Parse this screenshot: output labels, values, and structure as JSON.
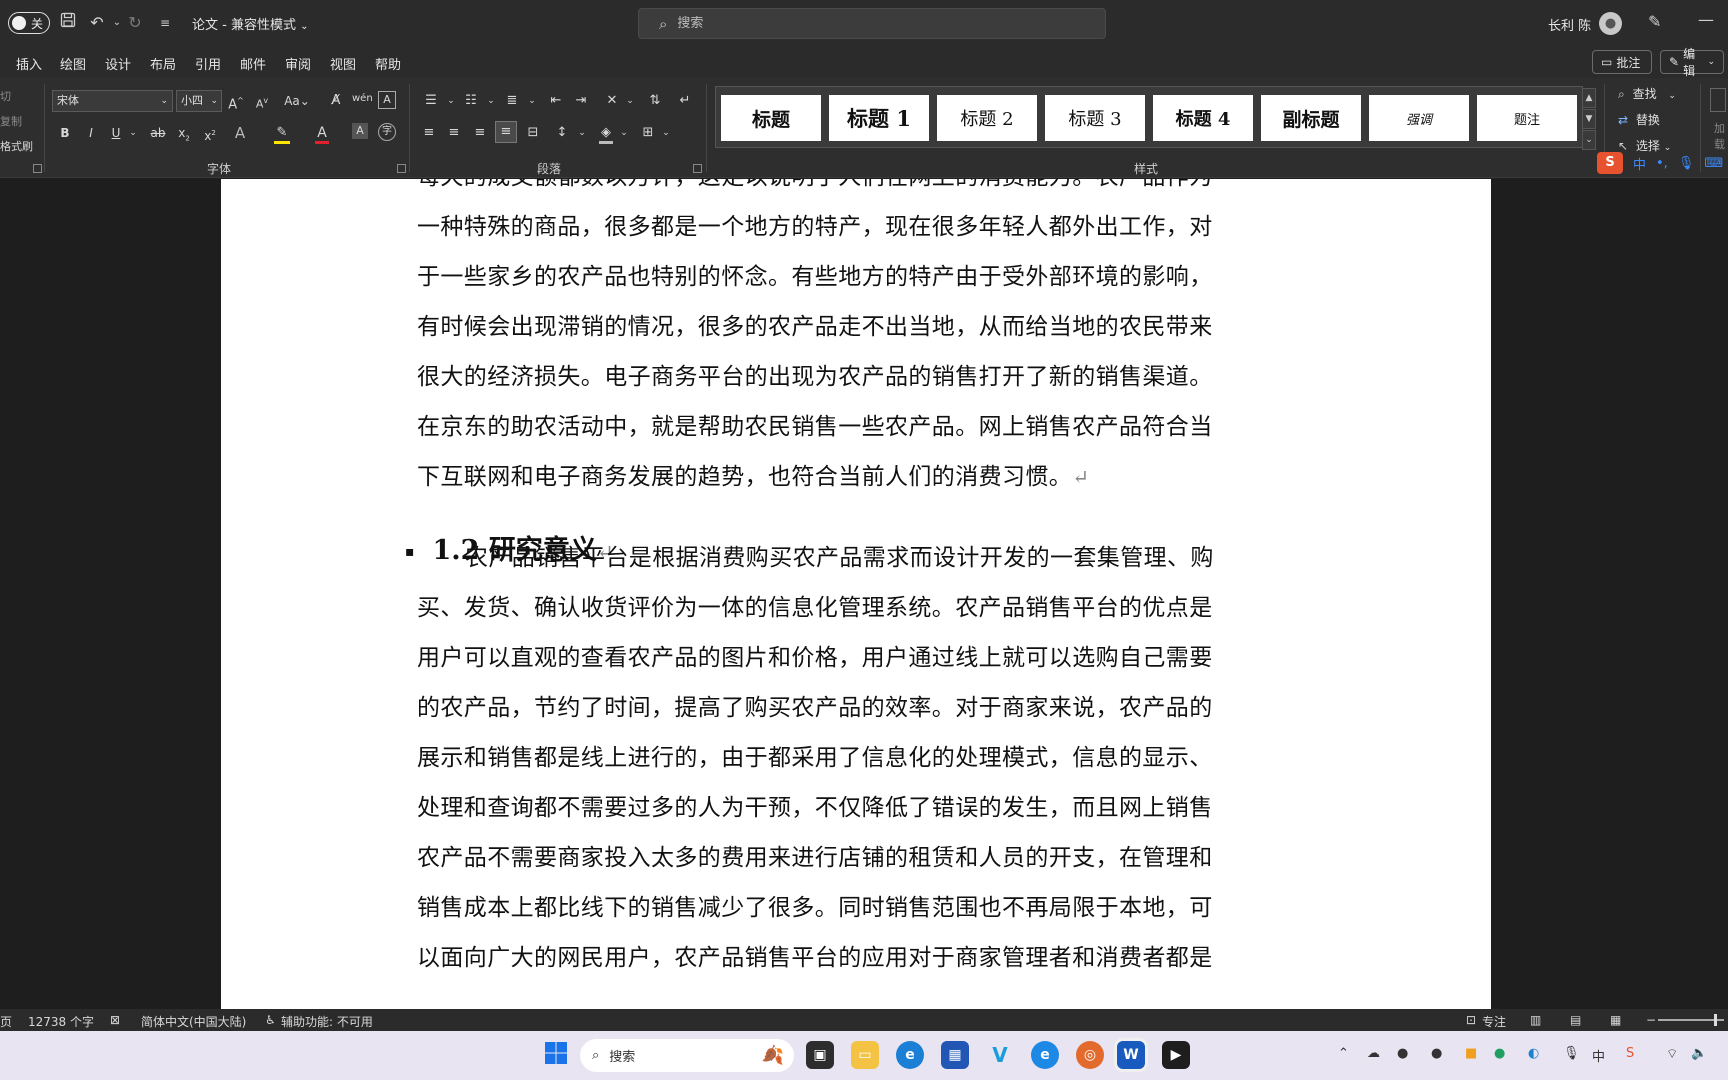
{
  "titlebar": {
    "autosave_label": "关",
    "doc_title": "论文 - 兼容性模式",
    "search_placeholder": "搜索",
    "user_name": "长利 陈",
    "icons": [
      "save-icon",
      "undo-icon",
      "redo-icon",
      "customize-icon",
      "avatar-icon",
      "pen-icon",
      "minimize-icon"
    ]
  },
  "tabs": [
    "插入",
    "绘图",
    "设计",
    "布局",
    "引用",
    "邮件",
    "审阅",
    "视图",
    "帮助"
  ],
  "tab_actions": {
    "comment": "批注",
    "edit": "编辑"
  },
  "ribbon": {
    "clipboard": [
      "切",
      "复制",
      "格式刷"
    ],
    "font_name": "宋体",
    "font_size": "小四",
    "groups": {
      "font": "字体",
      "paragraph": "段落",
      "styles": "样式"
    },
    "styles": [
      {
        "label": "标题"
      },
      {
        "label": "标题 1"
      },
      {
        "label": "标题 2"
      },
      {
        "label": "标题 3"
      },
      {
        "label": "标题 4"
      },
      {
        "label": "副标题"
      },
      {
        "label": "强调"
      },
      {
        "label": "题注"
      }
    ],
    "editing": {
      "find": "查找",
      "replace": "替换",
      "select": "选择"
    },
    "right_cut": [
      "加",
      "载"
    ]
  },
  "ime": {
    "logo": "S",
    "mode": "中",
    "punct": "•,",
    "mic": "🎤",
    "keyboard": "⌨"
  },
  "document": {
    "para1_lines": [
      "每天的成交额都数以万计，这足以说明了人们在网上的消费能力。农产品作为",
      "一种特殊的商品，很多都是一个地方的特产，现在很多年轻人都外出工作，对",
      "于一些家乡的农产品也特别的怀念。有些地方的特产由于受外部环境的影响，",
      "有时候会出现滞销的情况，很多的农产品走不出当地，从而给当地的农民带来",
      "很大的经济损失。电子商务平台的出现为农产品的销售打开了新的销售渠道。",
      "在京东的助农活动中，就是帮助农民销售一些农产品。网上销售农产品符合当",
      "下互联网和电子商务发展的趋势，也符合当前人们的消费习惯。"
    ],
    "return_mark": "↵",
    "heading": "1.2  研究意义",
    "heading_bullet": "▪",
    "para2_lines": [
      "农产品销售平台是根据消费购买农产品需求而设计开发的一套集管理、购",
      "买、发货、确认收货评价为一体的信息化管理系统。农产品销售平台的优点是",
      "用户可以直观的查看农产品的图片和价格，用户通过线上就可以选购自己需要",
      "的农产品，节约了时间，提高了购买农产品的效率。对于商家来说，农产品的",
      "展示和销售都是线上进行的，由于都采用了信息化的处理模式，信息的显示、",
      "处理和查询都不需要过多的人为干预，不仅降低了错误的发生，而且网上销售",
      "农产品不需要商家投入太多的费用来进行店铺的租赁和人员的开支，在管理和",
      "销售成本上都比线下的销售减少了很多。同时销售范围也不再局限于本地，可",
      "以面向广大的网民用户，农产品销售平台的应用对于商家管理者和消费者都是"
    ]
  },
  "status": {
    "page": "页",
    "word_count": "12738 个字",
    "language": "简体中文(中国大陆)",
    "accessibility": "辅助功能: 不可用",
    "focus": "专注"
  },
  "taskbar": {
    "search_placeholder": "搜索"
  },
  "tray": {
    "ime_mode": "中"
  }
}
